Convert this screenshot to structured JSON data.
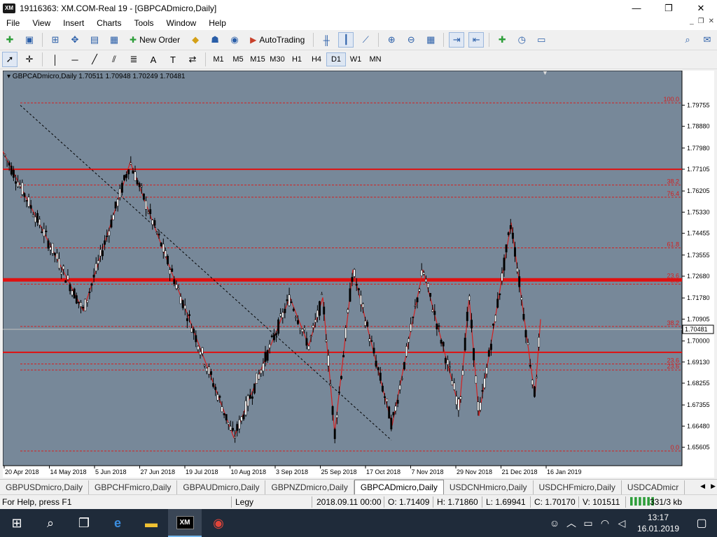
{
  "window": {
    "title": "19116363: XM.COM-Real 19 - [GBPCADmicro,Daily]",
    "logo": "XM",
    "minimize": "—",
    "maximize": "❐",
    "close": "✕"
  },
  "menu": {
    "items": [
      "File",
      "View",
      "Insert",
      "Charts",
      "Tools",
      "Window",
      "Help"
    ],
    "mdi": [
      "_",
      "❐",
      "✕"
    ]
  },
  "toolbar": {
    "new_order": "New Order",
    "auto_trading": "AutoTrading"
  },
  "timeframes": [
    "M1",
    "M5",
    "M15",
    "M30",
    "H1",
    "H4",
    "D1",
    "W1",
    "MN"
  ],
  "active_timeframe": "D1",
  "chart": {
    "symbol_line": "GBPCADmicro,Daily  1.70511 1.70948 1.70249 1.70481",
    "bg_color": "#778899",
    "current_price": "1.70481",
    "price_labels": [
      "1.79755",
      "1.78880",
      "1.77980",
      "1.77105",
      "1.76205",
      "1.75330",
      "1.74455",
      "1.73555",
      "1.72680",
      "1.71780",
      "1.70905",
      "1.70000",
      "1.69130",
      "1.68255",
      "1.67355",
      "1.66480",
      "1.65605"
    ],
    "date_labels": [
      "20 Apr 2018",
      "14 May 2018",
      "5 Jun 2018",
      "27 Jun 2018",
      "19 Jul 2018",
      "10 Aug 2018",
      "3 Sep 2018",
      "25 Sep 2018",
      "17 Oct 2018",
      "7 Nov 2018",
      "29 Nov 2018",
      "21 Dec 2018",
      "16 Jan 2019"
    ],
    "fib_levels": [
      {
        "label": "100.0",
        "price": 1.7985
      },
      {
        "label": "38.2",
        "price": 1.7645
      },
      {
        "label": "76.4",
        "price": 1.7595
      },
      {
        "label": "61.8",
        "price": 1.7385
      },
      {
        "label": "23.6",
        "price": 1.7255
      },
      {
        "label": "0.0",
        "price": 1.7235
      },
      {
        "label": "38.2",
        "price": 1.706
      },
      {
        "label": "23.6",
        "price": 1.6905
      },
      {
        "label": "23.6",
        "price": 1.688
      },
      {
        "label": "0.0",
        "price": 1.6545
      }
    ]
  },
  "tabs": [
    "GBPUSDmicro,Daily",
    "GBPCHFmicro,Daily",
    "GBPAUDmicro,Daily",
    "GBPNZDmicro,Daily",
    "GBPCADmicro,Daily",
    "USDCNHmicro,Daily",
    "USDCHFmicro,Daily",
    "USDCADmicr"
  ],
  "active_tab": "GBPCADmicro,Daily",
  "status": {
    "help": "For Help, press F1",
    "profile": "Legy",
    "datetime": "2018.09.11 00:00",
    "open": "O: 1.71409",
    "high": "H: 1.71860",
    "low": "L: 1.69941",
    "close": "C: 1.70170",
    "volume": "V: 101511",
    "traffic": "331/3 kb"
  },
  "taskbar": {
    "time": "13:17",
    "date": "16.01.2019"
  },
  "icons": [
    "windows-start-icon",
    "search-icon",
    "task-view-icon",
    "edge-icon",
    "file-explorer-icon",
    "xm-terminal-icon",
    "chrome-icon",
    "people-icon",
    "tray-chevron-icon",
    "battery-icon",
    "wifi-icon",
    "volume-icon",
    "notification-icon"
  ]
}
